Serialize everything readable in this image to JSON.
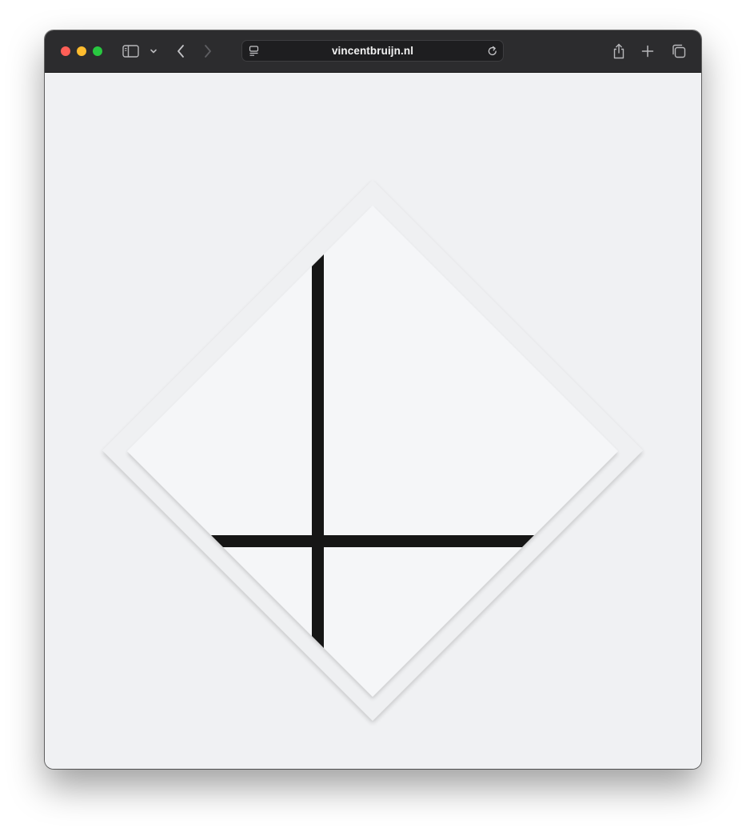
{
  "browser": {
    "url": "vincentbruijn.nl",
    "traffic_lights": {
      "close_color": "#ff5f57",
      "minimize_color": "#febc2e",
      "zoom_color": "#28c840"
    },
    "toolbar_color": "#2c2c2e"
  },
  "page": {
    "background_color": "#f0f1f3",
    "artwork": {
      "style": "Mondrian lozenge composition",
      "canvas_color": "#f5f6f8",
      "line_color": "#161616"
    }
  }
}
